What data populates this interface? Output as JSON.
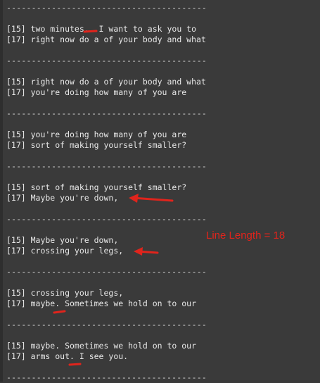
{
  "separator": "----------------------------------------",
  "lines": [
    "[15] two minutes.. I want to ask you to",
    "[17] right now do a of your body and what",
    "[15] right now do a of your body and what",
    "[17] you're doing how many of you are",
    "[15] you're doing how many of you are",
    "[17] sort of making yourself smaller?",
    "[15] sort of making yourself smaller?",
    "[17] Maybe you're down,",
    "[15] Maybe you're down,",
    "[17] crossing your legs,",
    "[15] crossing your legs,",
    "[17] maybe. Sometimes we hold on to our",
    "[15] maybe. Sometimes we hold on to our",
    "[17] arms out. I see you."
  ],
  "annotation": {
    "text": "Line Length = 18",
    "color": "#e0241c"
  }
}
